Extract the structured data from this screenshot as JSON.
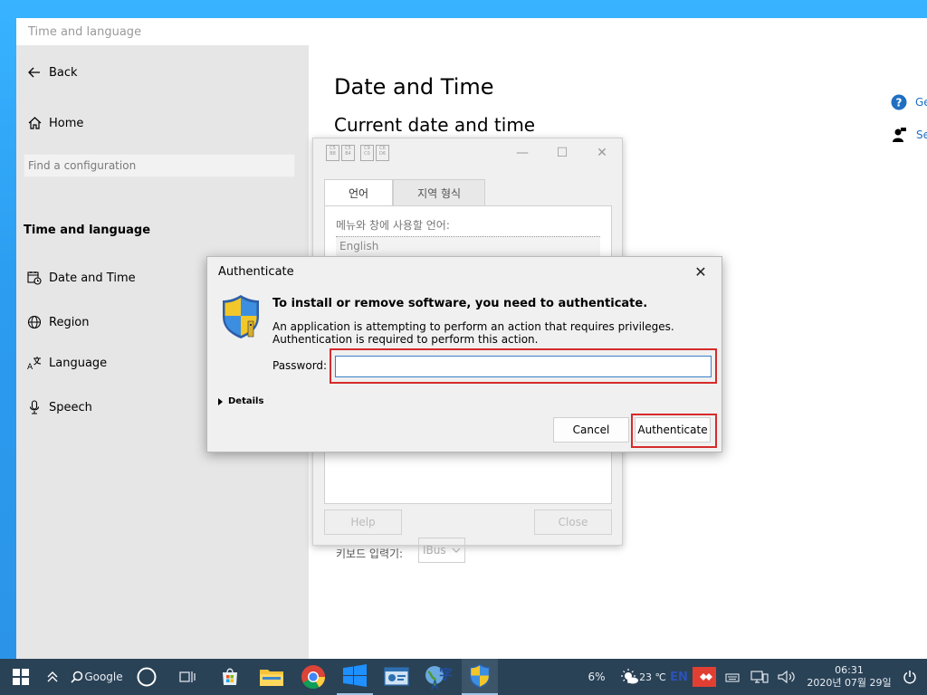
{
  "settings": {
    "window_title": "Time and language",
    "back_label": "Back",
    "home_label": "Home",
    "search_placeholder": "Find a configuration",
    "section_title": "Time and language",
    "nav": [
      {
        "label": "Date and Time",
        "icon": "calendar-clock-icon"
      },
      {
        "label": "Region",
        "icon": "globe-icon"
      },
      {
        "label": "Language",
        "icon": "language-icon"
      },
      {
        "label": "Speech",
        "icon": "microphone-icon"
      }
    ],
    "page_title": "Date and Time",
    "sub_title": "Current date and time",
    "help_links": [
      {
        "label": "Ge",
        "icon": "help-icon"
      },
      {
        "label": "Se",
        "icon": "feedback-icon"
      }
    ]
  },
  "lang_dialog": {
    "tabs": [
      "언어",
      "지역 형식"
    ],
    "menu_language_label": "메뉴와 창에 사용할 언어:",
    "menu_language_value": "English",
    "keyboard_label": "키보드 입력기:",
    "keyboard_value": "IBus",
    "help_button": "Help",
    "close_button": "Close"
  },
  "auth_dialog": {
    "title": "Authenticate",
    "heading": "To install or remove software, you need to authenticate.",
    "body": "An application is attempting to perform an action that requires privileges. Authentication is required to perform this action.",
    "password_label": "Password:",
    "password_value": "",
    "details_label": "Details",
    "cancel_label": "Cancel",
    "authenticate_label": "Authenticate"
  },
  "taskbar": {
    "search_label": "Google",
    "battery": "6%",
    "weather": "23 ℃",
    "input_lang": "EN",
    "time": "06:31",
    "date": "2020년 07월 29일"
  },
  "colors": {
    "accent_blue": "#1f6fc1",
    "highlight_red": "#d62b2b",
    "taskbar": "#2a4256",
    "desktop": "#2ea0f0"
  }
}
